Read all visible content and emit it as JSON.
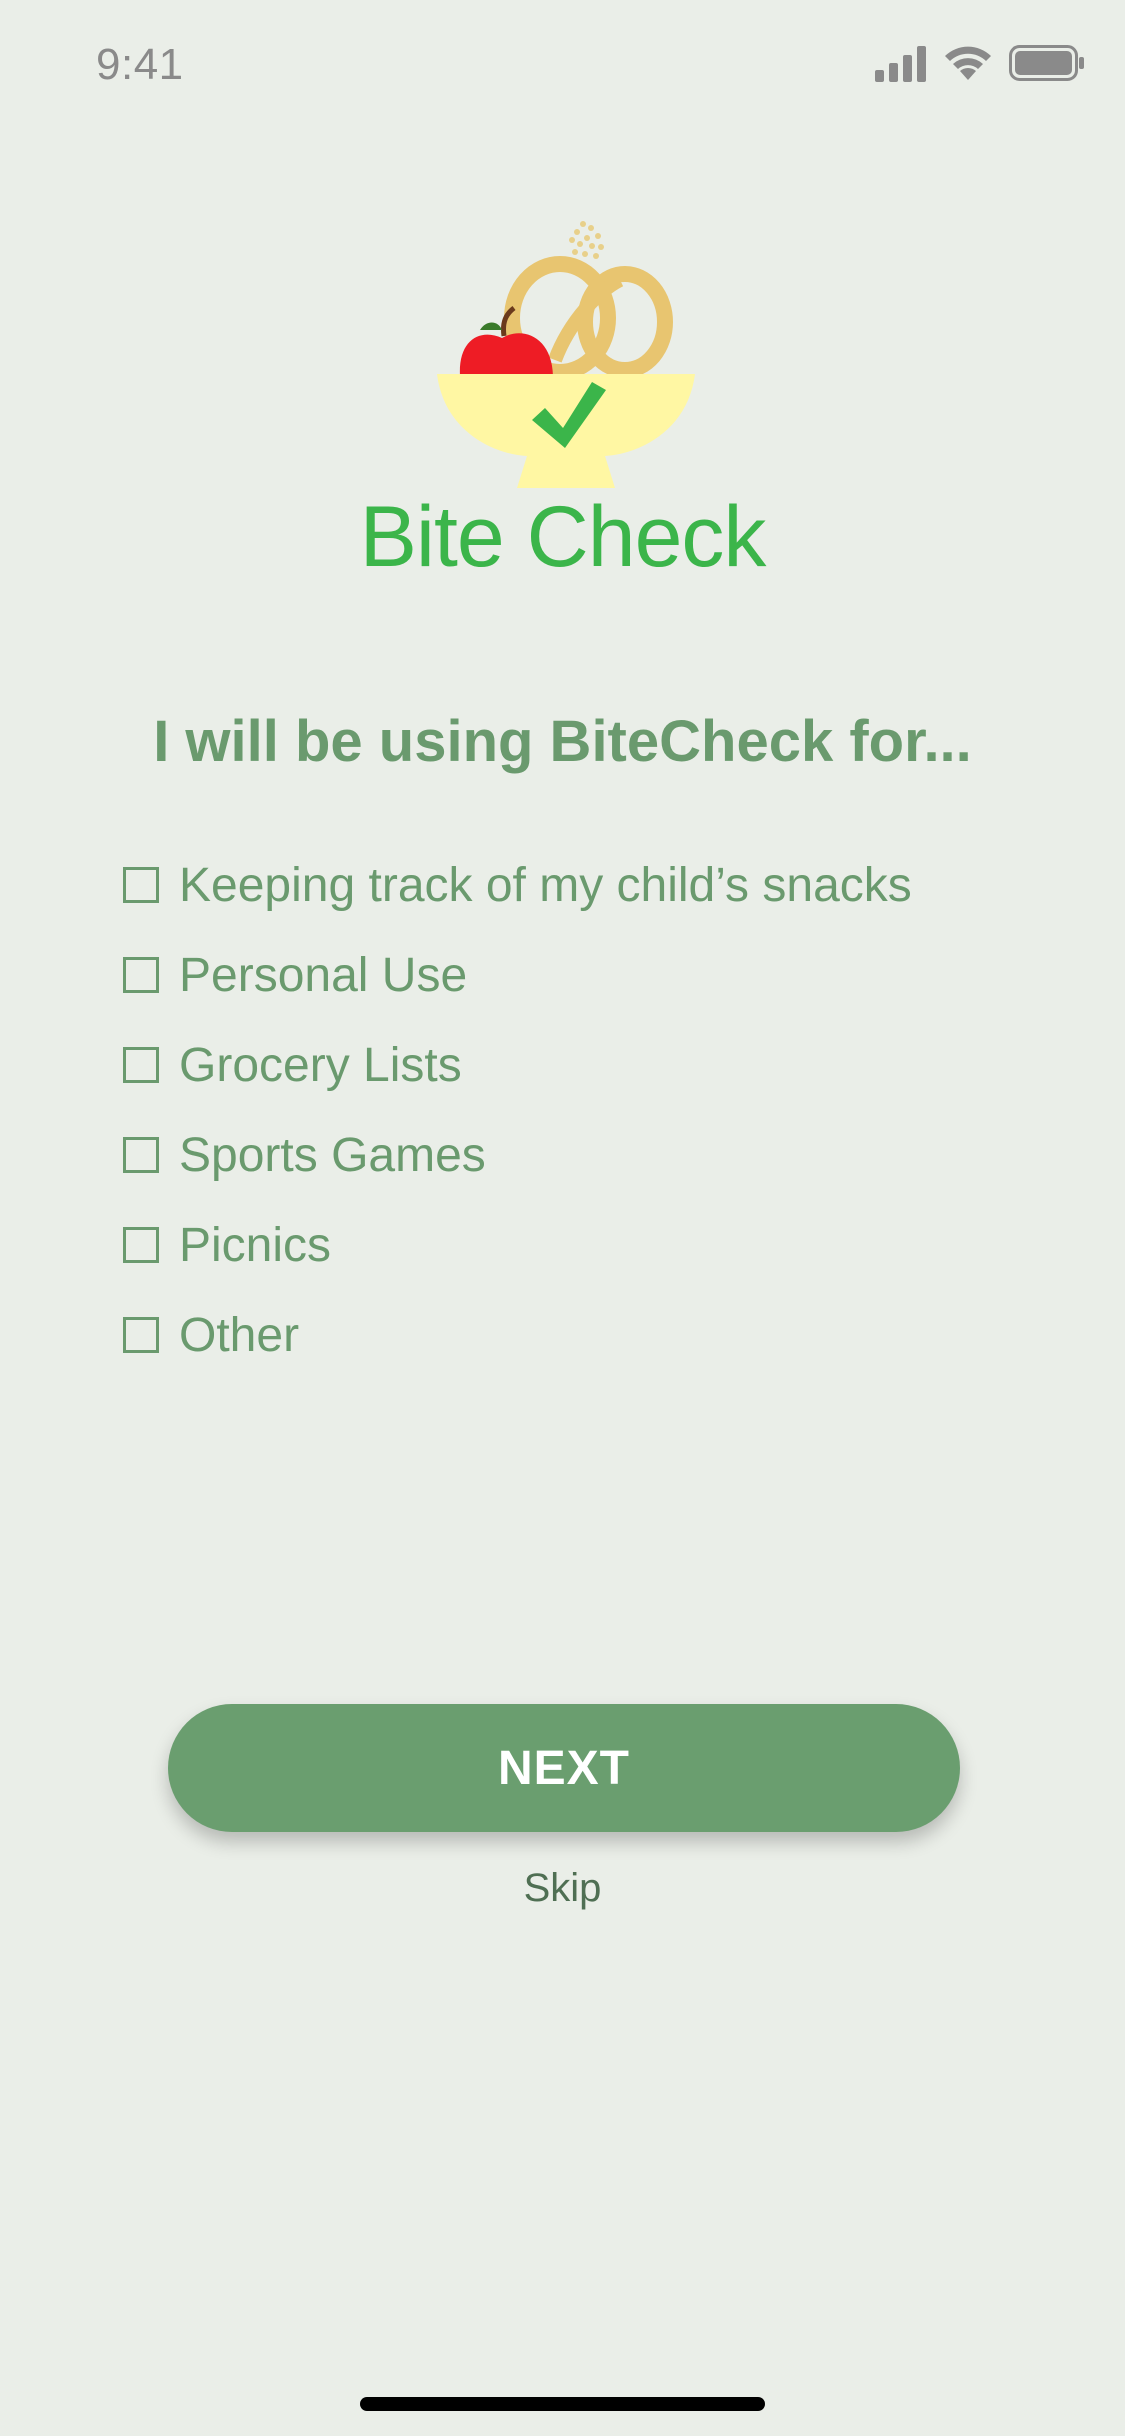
{
  "status_bar": {
    "time": "9:41",
    "icons": [
      "signal-icon",
      "wifi-icon",
      "battery-icon"
    ]
  },
  "brand": {
    "name": "Bite Check",
    "logo_icon": "apple-pretzel-bowl-check-logo",
    "color": "#3bb54a"
  },
  "question": "I will be using BiteCheck for...",
  "options": [
    {
      "label": "Keeping track of my child’s snacks",
      "checked": false
    },
    {
      "label": "Personal Use",
      "checked": false
    },
    {
      "label": "Grocery Lists",
      "checked": false
    },
    {
      "label": "Sports Games",
      "checked": false
    },
    {
      "label": "Picnics",
      "checked": false
    },
    {
      "label": "Other",
      "checked": false
    }
  ],
  "next_button": {
    "label": "NEXT",
    "color": "#6a9e6f"
  },
  "skip_link": {
    "label": "Skip"
  },
  "theme": {
    "background": "#eaeee8",
    "text_green": "#6a9a6e"
  }
}
